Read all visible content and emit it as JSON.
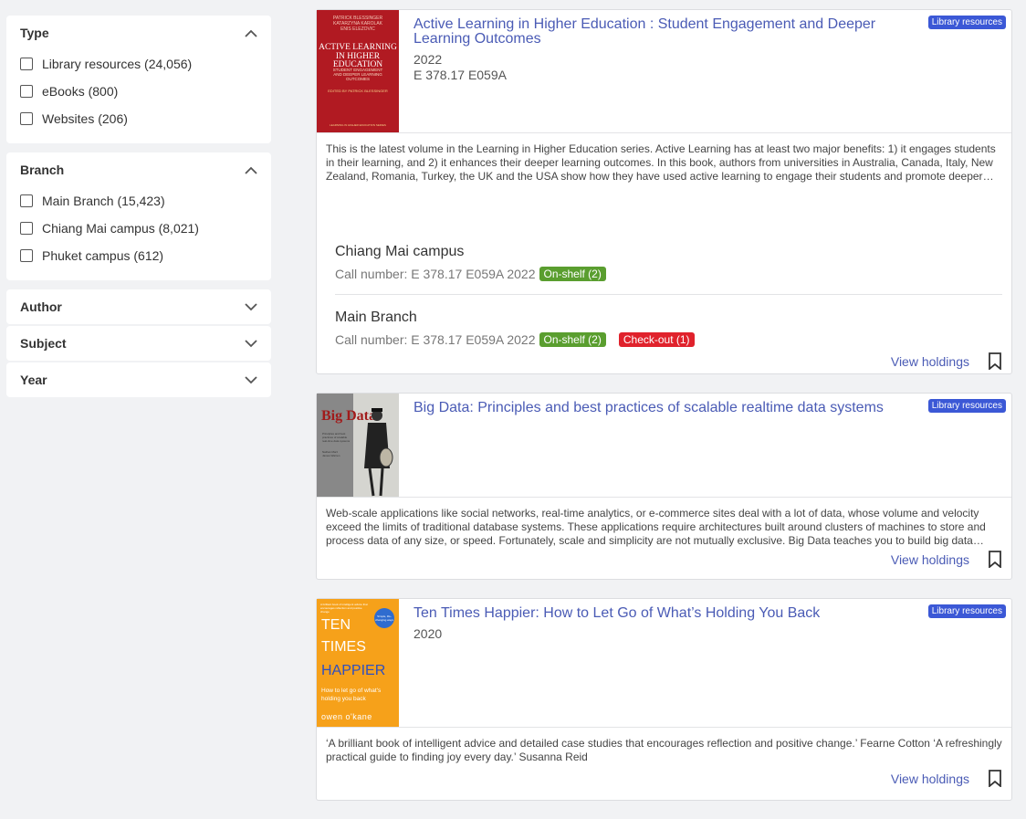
{
  "facets": {
    "type": {
      "title": "Type",
      "options": [
        "Library resources (24,056)",
        "eBooks (800)",
        "Websites (206)"
      ]
    },
    "branch": {
      "title": "Branch",
      "options": [
        "Main Branch (15,423)",
        "Chiang Mai campus (8,021)",
        "Phuket campus (612)"
      ]
    },
    "author": {
      "title": "Author"
    },
    "subject": {
      "title": "Subject"
    },
    "year": {
      "title": "Year"
    }
  },
  "results": [
    {
      "title": "Active Learning in Higher Education : Student Engagement and Deeper Learning Outcomes",
      "year": "2022",
      "call": "E 378.17 E059A",
      "badge": "Library resources",
      "description": "This is the latest volume in the Learning in Higher Education series. Active Learning has at least two major benefits: 1) it engages students in their learning, and 2) it enhances their deeper learning outcomes. In this book, authors from universities in Australia, Canada, Italy, New Zealand, Romania, Turkey, the UK and the USA show how they have used active learning to engage their students and promote deeper learning outcomes.",
      "cover": {
        "authors": "PATRICK BLESSINGER\nKATARZYNA KAROLAK\nENIS ELEZOVIC",
        "title": "ACTIVE LEARNING\nIN HIGHER\nEDUCATION",
        "subtitle": "STUDENT ENGAGEMENT\nAND DEEPER LEARNING\nOUTCOMES",
        "editor": "EDITED BY PATRICK BLESSINGER",
        "footer": "LEARNING IN HIGHER EDUCATION SERIES"
      },
      "holdings": [
        {
          "branch": "Chiang Mai campus",
          "call_number": "Call number: E 378.17 E059A 2022",
          "statuses": [
            "On-shelf (2)"
          ]
        },
        {
          "branch": "Main Branch",
          "call_number": "Call number: E 378.17 E059A 2022",
          "statuses": [
            "On-shelf (2)",
            "Check-out (1)"
          ]
        }
      ],
      "view_label": "View holdings"
    },
    {
      "title": "Big Data: Principles and best practices of scalable realtime data systems",
      "badge": "Library resources",
      "description": "Web-scale applications like social networks, real-time analytics, or e-commerce sites deal with a lot of data, whose volume and velocity exceed the limits of traditional database systems. These applications require architectures built around clusters of machines to store and process data of any size, or speed. Fortunately, scale and simplicity are not mutually exclusive. Big Data teaches you to build big data systems using an architecture designed specifically to capture and analyze web-scale data.",
      "cover": {
        "title": "Big Data",
        "subtitle": "Principles and best practices of scalable real-time data systems",
        "author": "Nathan Marz\nJames Warren"
      },
      "view_label": "View holdings"
    },
    {
      "title": "Ten Times Happier: How to Let Go of What’s Holding You Back",
      "year": "2020",
      "badge": "Library resources",
      "description": "‘A brilliant book of intelligent advice and detailed case studies that encourages reflection and positive change.’ Fearne Cotton ‘A refreshingly practical guide to finding joy every day.’ Susanna Reid",
      "cover": {
        "tagline": "A brilliant book of intelligent advice that encourages reflection and positive change",
        "circle": "Simple, life-changing ways",
        "t1": "TEN",
        "t2": "TIMES",
        "t3": "HAPPIER",
        "sub": "How to let go of what's holding you back",
        "author": "owen o'kane"
      },
      "view_label": "View holdings"
    }
  ],
  "colors": {
    "accent": "#4a5bb5",
    "badge": "#3b58d6",
    "onshelf": "#5a9e2f",
    "checkout": "#e0222c"
  }
}
